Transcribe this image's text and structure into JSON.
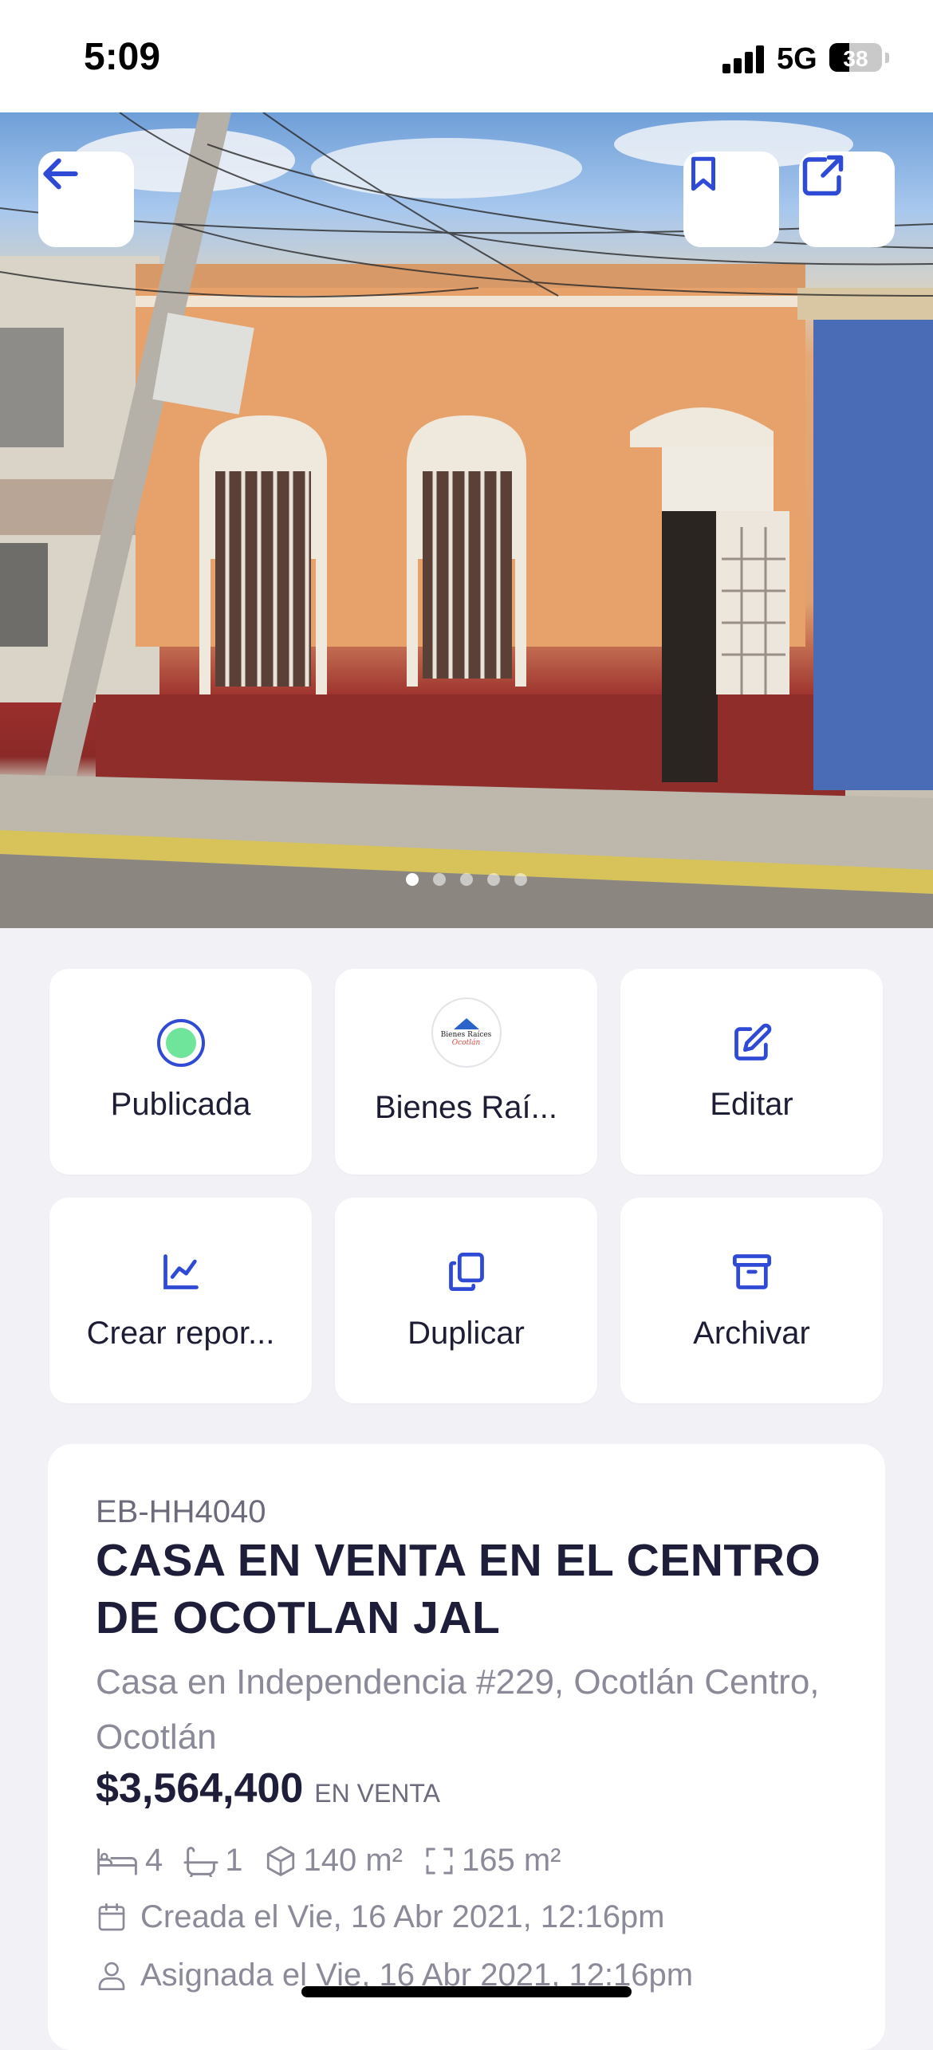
{
  "status": {
    "time": "5:09",
    "network": "5G",
    "battery": 38
  },
  "hero": {
    "photo_index": 1,
    "photo_count": 5,
    "back_button": "back-arrow-icon",
    "bookmark_button": "bookmark-icon",
    "share_button": "share-icon"
  },
  "actions": [
    {
      "label": "Publicada",
      "icon": "status-dot-icon",
      "color": "#6ee59a"
    },
    {
      "label": "Bienes Raí...",
      "icon": "agency-logo"
    },
    {
      "label": "Editar",
      "icon": "edit-icon"
    },
    {
      "label": "Crear repor...",
      "icon": "chart-icon"
    },
    {
      "label": "Duplicar",
      "icon": "duplicate-icon"
    },
    {
      "label": "Archivar",
      "icon": "archive-icon"
    }
  ],
  "agency_logo": {
    "line1": "Bienes Raíces",
    "line2": "Ocotlán"
  },
  "property": {
    "code": "EB-HH4040",
    "title": "CASA EN VENTA EN EL CENTRO DE OCOTLAN JAL",
    "address": "Casa en Independencia #229, Ocotlán Centro, Ocotlán",
    "price": "$3,564,400",
    "operation": "EN VENTA",
    "bedrooms": "4",
    "bathrooms": "1",
    "construction": "140 m²",
    "lot": "165 m²",
    "created": "Creada el Vie, 16 Abr 2021, 12:16pm",
    "assigned": "Asignada el Vie, 16 Abr 2021, 12:16pm"
  },
  "theme": {
    "accent": "#2f4bd6",
    "text": "#1e1e3a",
    "muted": "#8a8a98",
    "background": "#f1f1f6"
  }
}
